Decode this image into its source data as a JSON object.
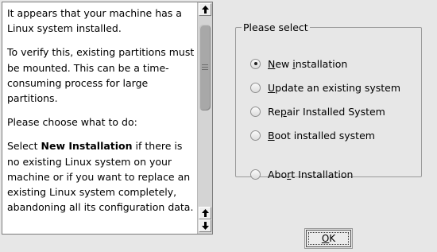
{
  "info_text": {
    "p1": "It appears that your machine has a Linux system installed.",
    "p2": "To verify this, existing partitions must be mounted. This can be a time-consuming process for large partitions.",
    "p3": "Please choose what to do:",
    "p4_prefix": "Select ",
    "p4_bold": "New Installation",
    "p4_suffix": " if there is no existing Linux system on your machine or if you want to replace an existing Linux system completely, abandoning all its configuration data."
  },
  "scrollbar": {
    "up_icon": "arrow-up-icon",
    "down_icon": "arrow-down-icon"
  },
  "options_group": {
    "legend": "Please select",
    "options": [
      {
        "pre": "",
        "key": "N",
        "post": "ew ",
        "key2": "i",
        "post2": "nstallation",
        "selected": true
      },
      {
        "pre": "",
        "key": "U",
        "post": "pdate an existing system",
        "selected": false
      },
      {
        "pre": "Re",
        "key": "p",
        "post": "air Installed System",
        "selected": false
      },
      {
        "pre": "",
        "key": "B",
        "post": "oot installed system",
        "selected": false
      },
      {
        "pre": "Abo",
        "key": "r",
        "post": "t Installation",
        "selected": false
      }
    ]
  },
  "ok_button": {
    "key": "O",
    "rest": "K"
  }
}
